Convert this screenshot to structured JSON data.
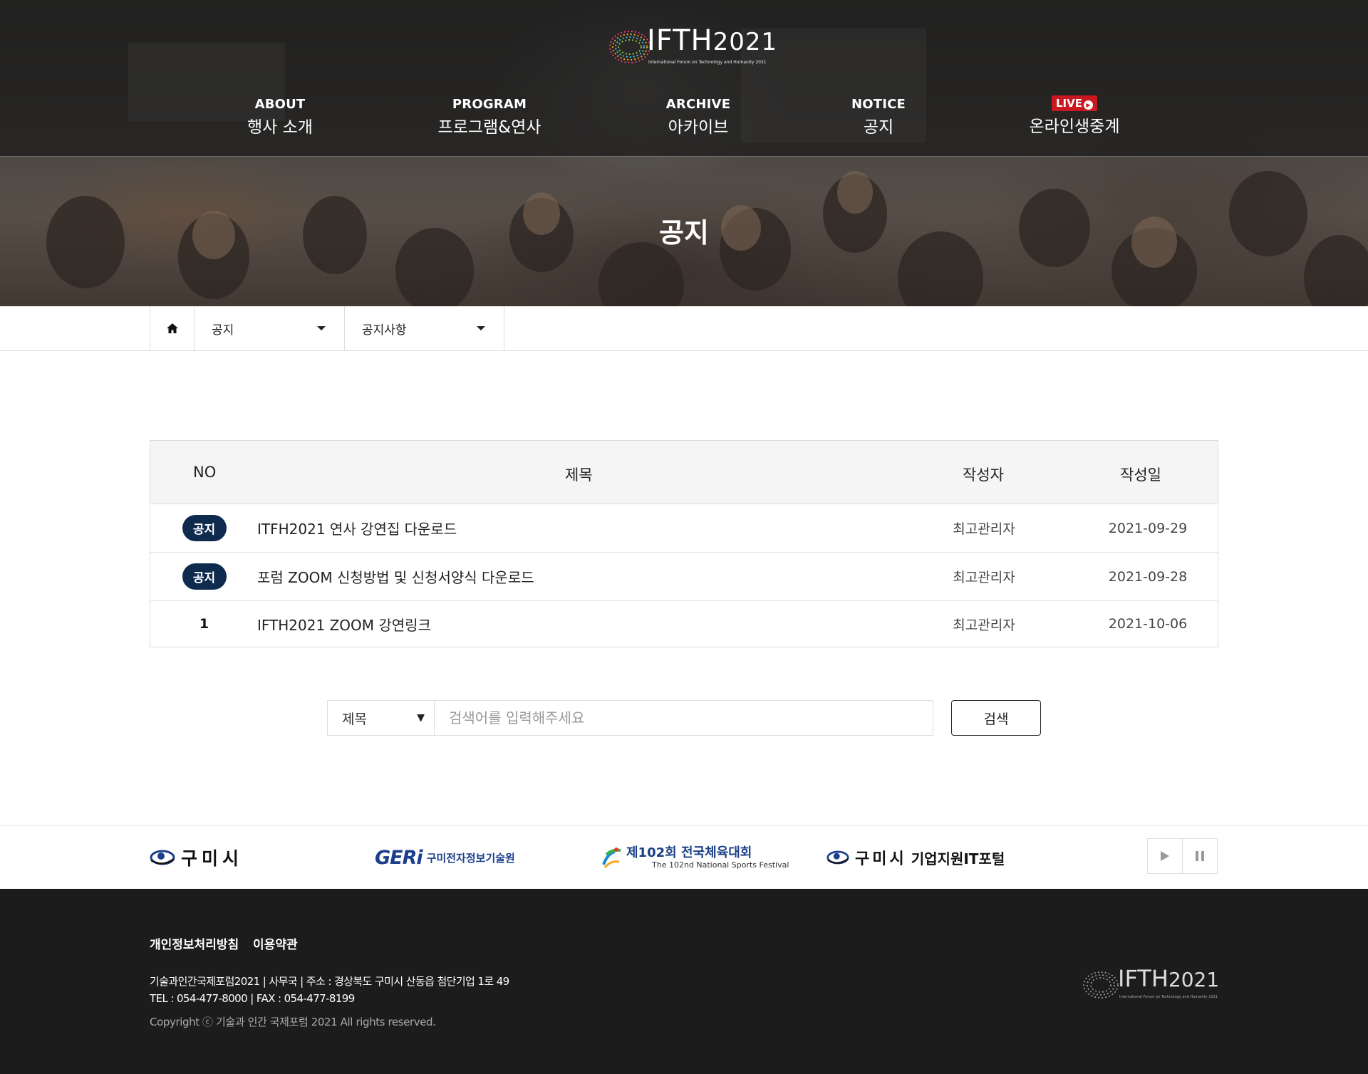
{
  "brand": {
    "logo_main": "IFTH",
    "logo_year": "2021",
    "logo_tagline": "International Forum on Technology and Humanity 2021"
  },
  "nav": [
    {
      "en": "ABOUT",
      "ko": "행사 소개"
    },
    {
      "en": "PROGRAM",
      "ko": "프로그램&연사"
    },
    {
      "en": "ARCHIVE",
      "ko": "아카이브"
    },
    {
      "en": "NOTICE",
      "ko": "공지"
    },
    {
      "en": "LIVE",
      "ko": "온라인생중계"
    }
  ],
  "page_title": "공지",
  "breadcrumb": {
    "level1": "공지",
    "level2": "공지사항"
  },
  "table": {
    "headers": {
      "no": "NO",
      "title": "제목",
      "writer": "작성자",
      "date": "작성일"
    },
    "rows": [
      {
        "no": "공지",
        "title": "ITFH2021 연사 강연집 다운로드",
        "writer": "최고관리자",
        "date": "2021-09-29"
      },
      {
        "no": "공지",
        "title": "포럼 ZOOM 신청방법 및 신청서양식 다운로드",
        "writer": "최고관리자",
        "date": "2021-09-28"
      },
      {
        "no": "1",
        "title": "IFTH2021 ZOOM 강연링크",
        "writer": "최고관리자",
        "date": "2021-10-06"
      }
    ]
  },
  "search": {
    "field_selected": "제목",
    "placeholder": "검색어를 입력해주세요",
    "button": "검색"
  },
  "partners": {
    "gumi": "구미시",
    "geri_main": "GERi",
    "geri_sub": "구미전자정보기술원",
    "sports_main": "제102회 전국체육대회",
    "sports_sub": "The 102nd National Sports Festival",
    "portal_city": "구미시",
    "portal_name": "기업지원IT포털"
  },
  "footer": {
    "privacy": "개인정보처리방침",
    "terms": "이용약관",
    "info_line1": "기술과인간국제포럼2021  |  사무국  |  주소 : 경상북도 구미시 산동읍 첨단기업 1로 49",
    "info_line2": "TEL : 054-477-8000  |  FAX : 054-477-8199",
    "copyright": "Copyright ⓒ 기술과 인간 국제포럼 2021 All rights reserved."
  },
  "colors": {
    "badge_navy": "#0e2a4d",
    "live_red": "#c9181f",
    "footer_bg": "#1c1c1c"
  }
}
